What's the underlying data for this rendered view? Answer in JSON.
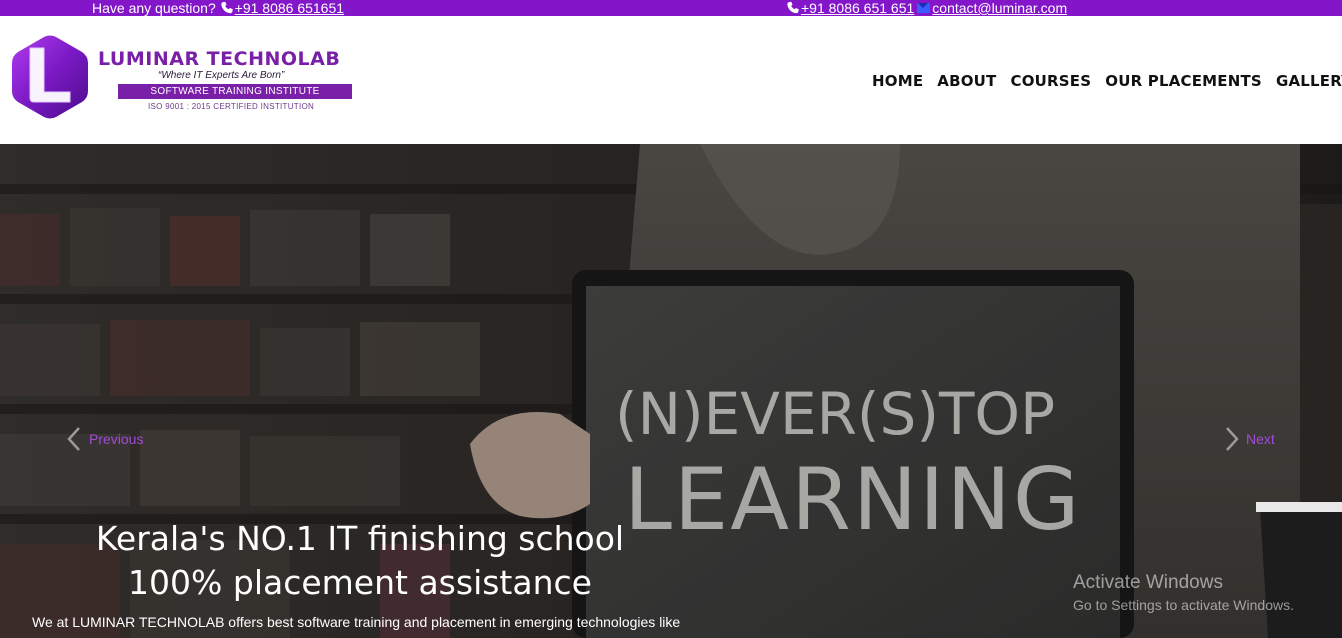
{
  "topbar": {
    "question_label": "Have any question?",
    "phone_left": "+91 8086 651651",
    "phone_right": "+91 8086 651 651",
    "email": "contact@luminar.com"
  },
  "brand": {
    "name": "LUMINAR TECHNOLAB",
    "tagline": "“Where IT Experts Are Born”",
    "subtitle": "SOFTWARE TRAINING INSTITUTE",
    "certification": "ISO 9001 : 2015 CERTIFIED INSTITUTION",
    "logo_letter": "L"
  },
  "nav": {
    "items": [
      {
        "label": "HOME"
      },
      {
        "label": "ABOUT"
      },
      {
        "label": "COURSES"
      },
      {
        "label": "OUR PLACEMENTS"
      },
      {
        "label": "GALLERY"
      }
    ]
  },
  "hero": {
    "chalk_text_line1": "(N)EVER(S)TOP",
    "chalk_text_line2": "LEARNING",
    "prev_label": "Previous",
    "next_label": "Next",
    "caption_line1": "Kerala's NO.1 IT finishing school",
    "caption_line2": "100% placement assistance",
    "caption_body": "We at LUMINAR TECHNOLAB offers best software training and placement in emerging technologies like"
  },
  "watermark": {
    "title": "Activate Windows",
    "subtitle": "Go to Settings to activate Windows."
  },
  "colors": {
    "brand_purple": "#8316c9",
    "control_purple": "#a24bd6"
  }
}
